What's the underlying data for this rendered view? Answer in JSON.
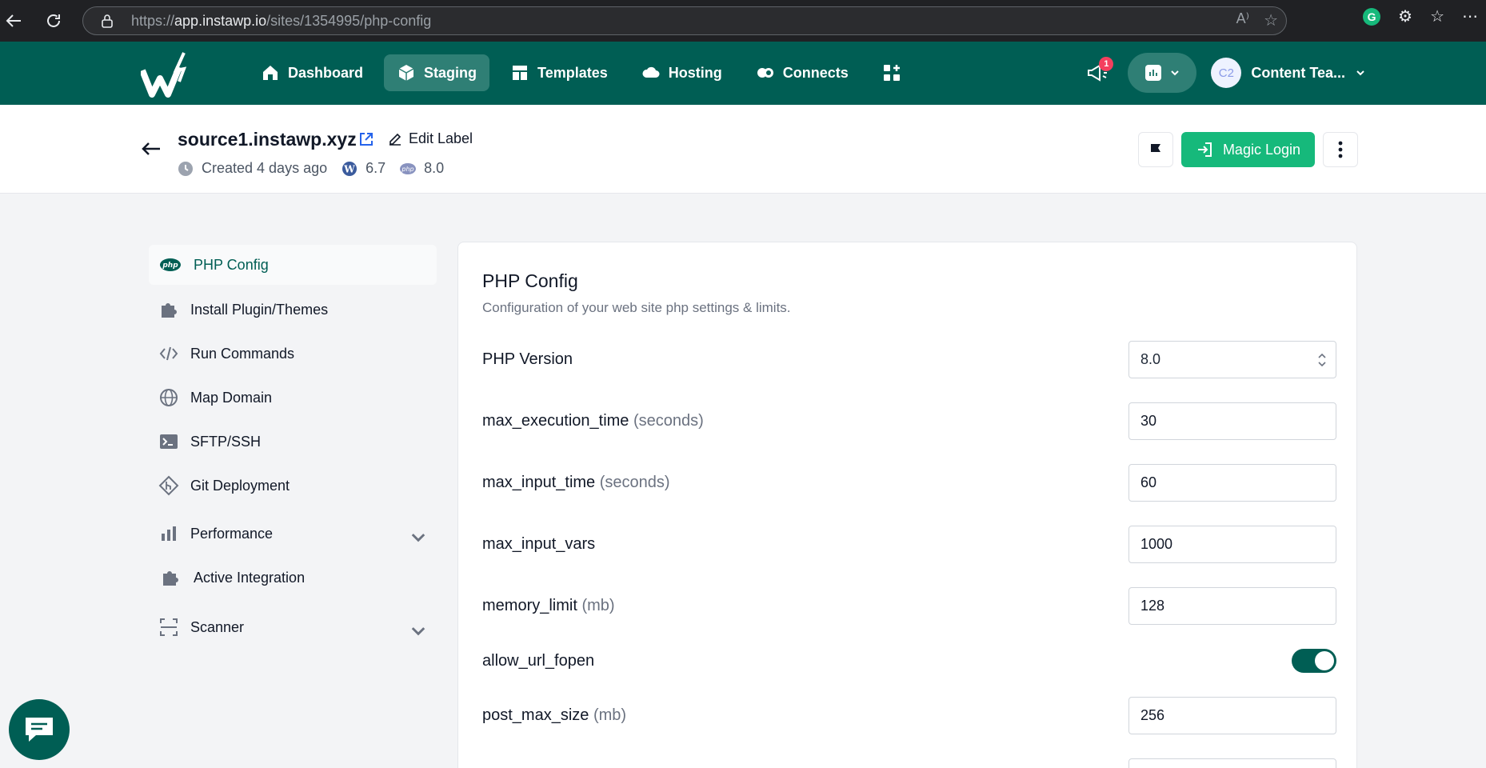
{
  "browser": {
    "url_prefix": "https://",
    "url_host": "app.instawp.io",
    "url_path": "/sites/1354995/php-config"
  },
  "nav": {
    "items": [
      {
        "label": "Dashboard",
        "icon": "home-icon"
      },
      {
        "label": "Staging",
        "icon": "cube-icon",
        "active": true
      },
      {
        "label": "Templates",
        "icon": "templates-icon"
      },
      {
        "label": "Hosting",
        "icon": "cloud-icon"
      },
      {
        "label": "Connects",
        "icon": "connects-icon"
      }
    ],
    "notification_count": "1",
    "avatar_initials": "C2",
    "user_name": "Content Tea..."
  },
  "site": {
    "name": "source1.instawp.xyz",
    "edit_label": "Edit Label",
    "created": "Created 4 days ago",
    "wp_version": "6.7",
    "php_version": "8.0",
    "magic_login": "Magic Login"
  },
  "sidebar": {
    "items": [
      {
        "label": "PHP Config",
        "icon": "php-icon"
      },
      {
        "label": "Install Plugin/Themes",
        "icon": "puzzle-icon"
      },
      {
        "label": "Run Commands",
        "icon": "code-icon"
      },
      {
        "label": "Map Domain",
        "icon": "globe-icon"
      },
      {
        "label": "SFTP/SSH",
        "icon": "terminal-icon"
      },
      {
        "label": "Git Deployment",
        "icon": "git-icon"
      },
      {
        "label": "Performance",
        "icon": "bar-chart-icon"
      },
      {
        "label": "Active Integration",
        "icon": "puzzle-icon"
      },
      {
        "label": "Scanner",
        "icon": "scan-icon"
      }
    ]
  },
  "main": {
    "title": "PHP Config",
    "description": "Configuration of your web site php settings & limits.",
    "php_version_label": "PHP Version",
    "php_version_value": "8.0",
    "fields": [
      {
        "name": "max_execution_time",
        "unit": "(seconds)",
        "value": "30"
      },
      {
        "name": "max_input_time",
        "unit": "(seconds)",
        "value": "60"
      },
      {
        "name": "max_input_vars",
        "unit": "",
        "value": "1000"
      },
      {
        "name": "memory_limit",
        "unit": "(mb)",
        "value": "128"
      }
    ],
    "allow_url_fopen_label": "allow_url_fopen",
    "post_max_size": {
      "name": "post_max_size",
      "unit": "(mb)",
      "value": "256"
    }
  },
  "colors": {
    "brand": "#005e54",
    "accent": "#16b97b",
    "badge": "#f43f5e"
  }
}
